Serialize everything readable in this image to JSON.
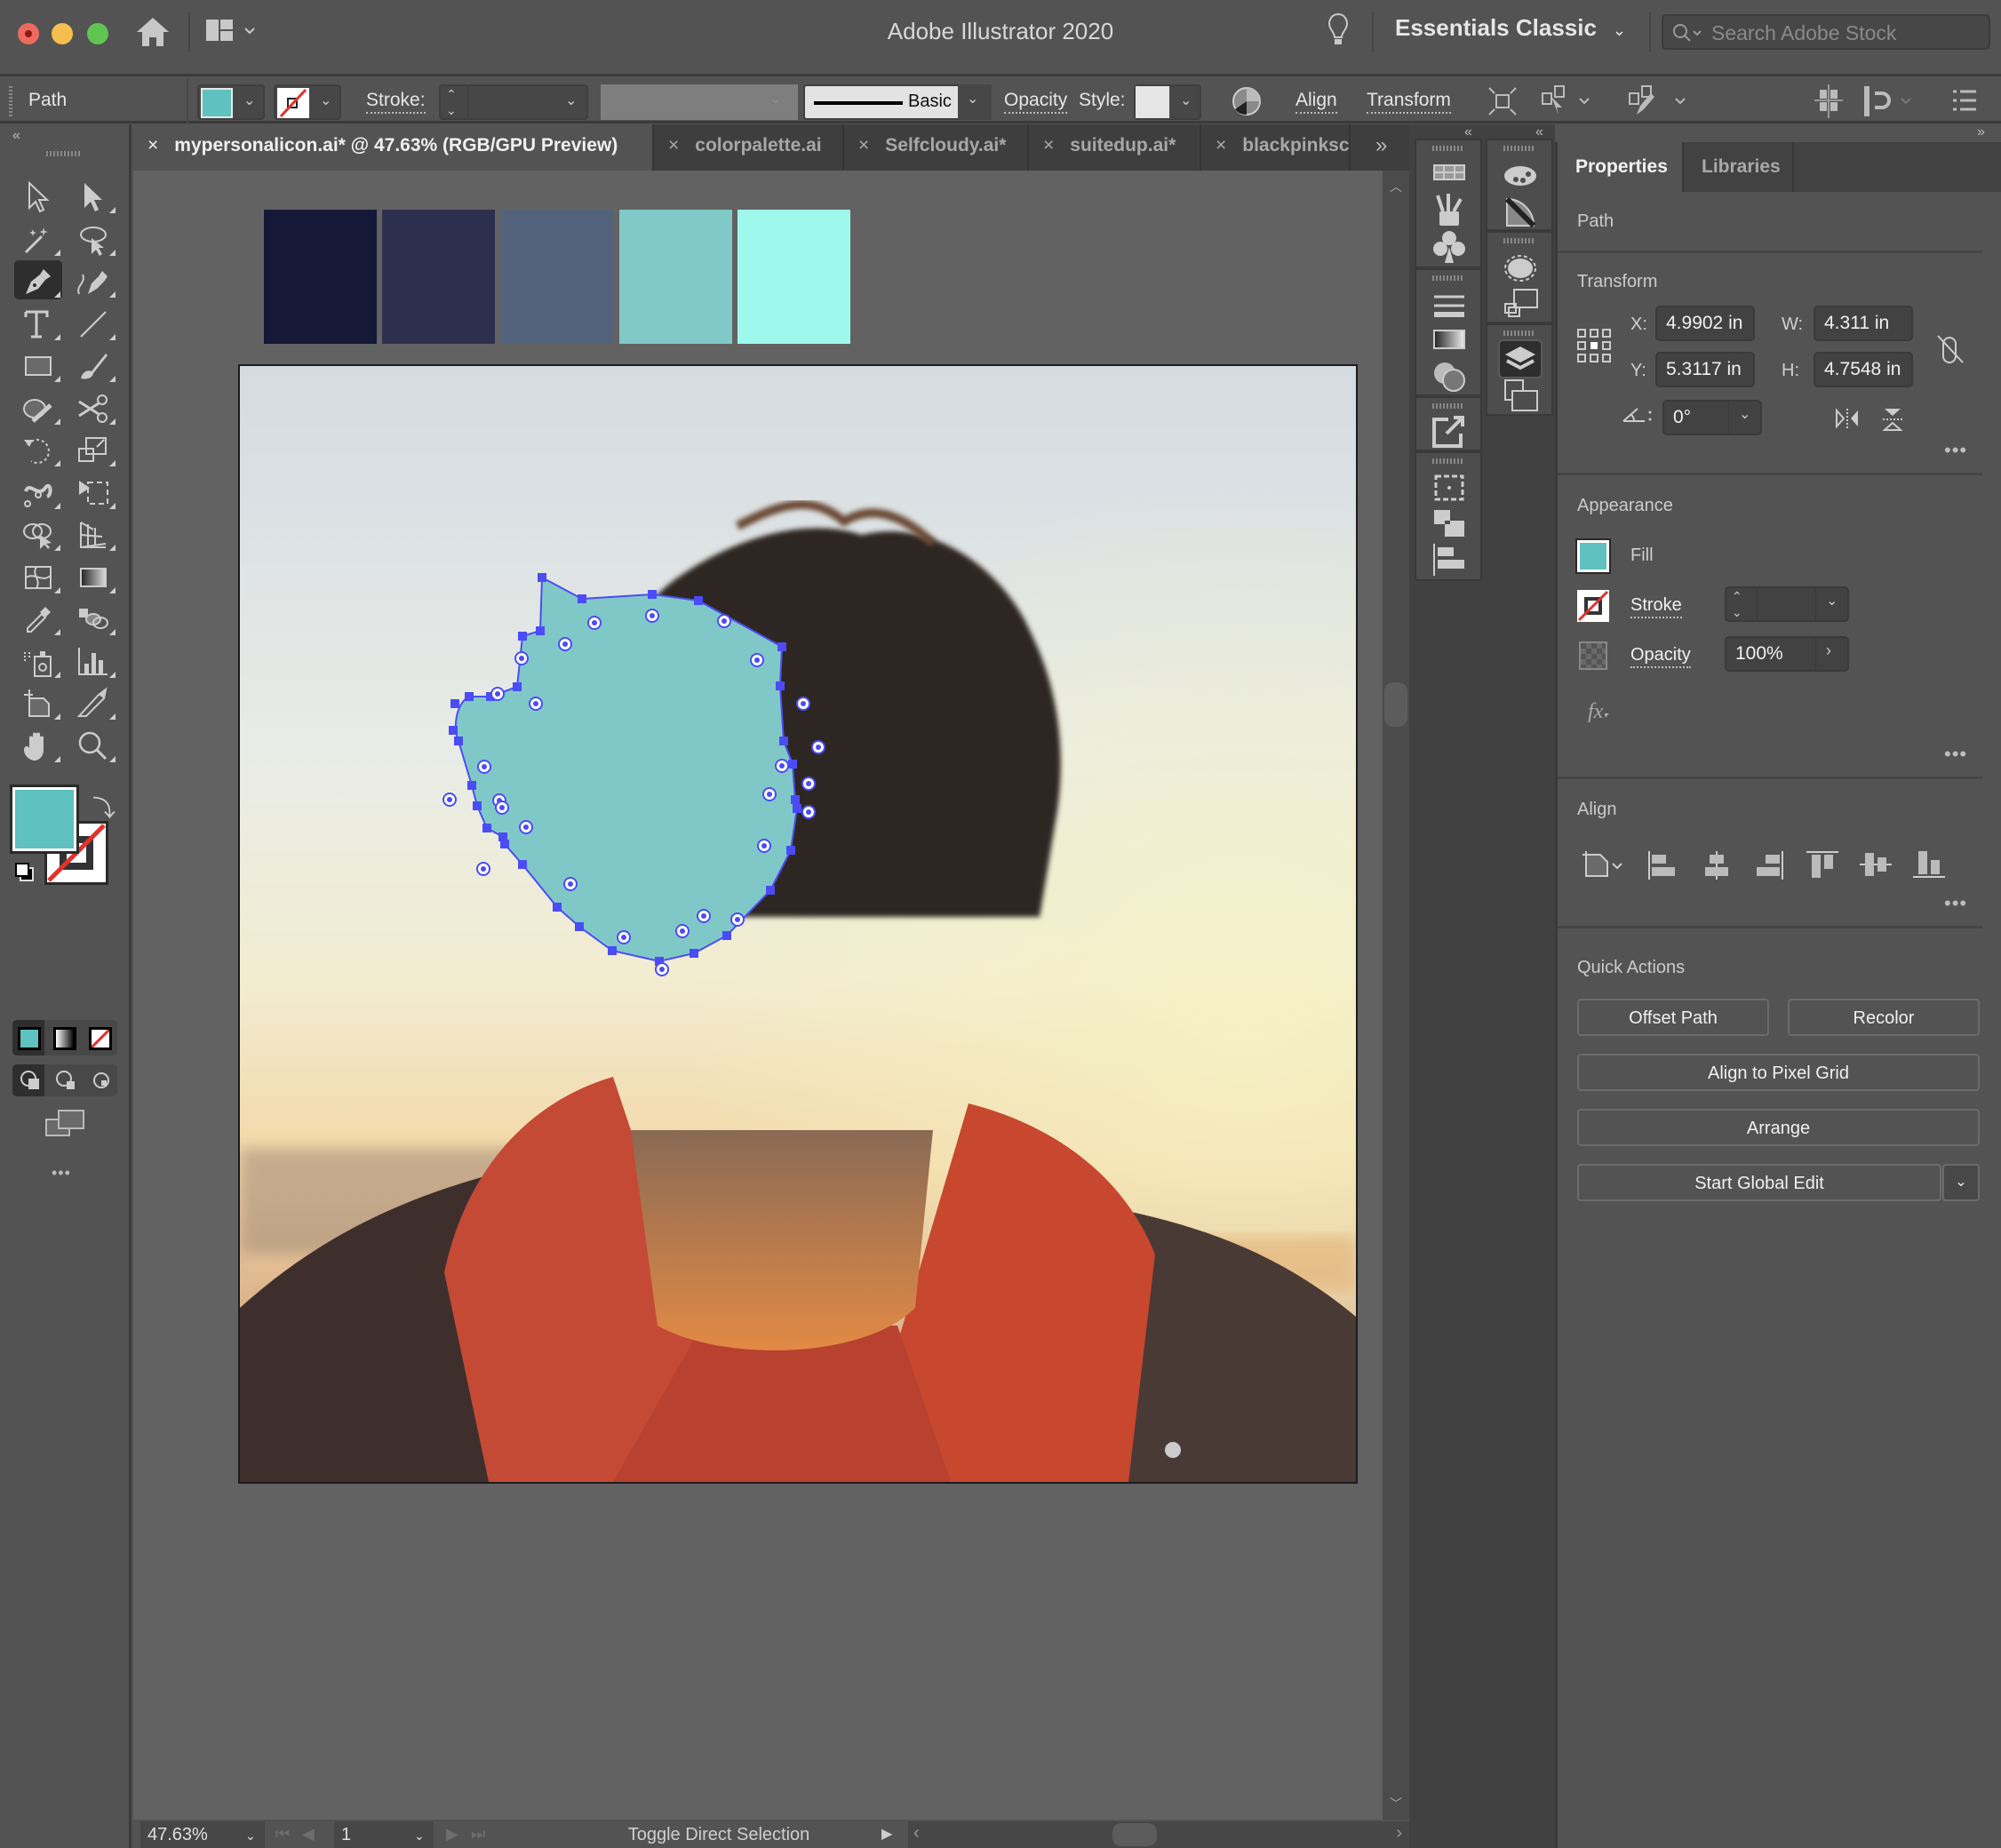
{
  "window": {
    "title": "Adobe Illustrator 2020",
    "workspace": "Essentials Classic",
    "search_placeholder": "Search Adobe Stock"
  },
  "control_bar": {
    "selection_type": "Path",
    "fill_color": "#5fc1c0",
    "stroke_label": "Stroke:",
    "stroke_weight": "",
    "brush_profile": "Basic",
    "opacity_label": "Opacity",
    "style_label": "Style:",
    "align_label": "Align",
    "transform_label": "Transform"
  },
  "tabs": [
    {
      "label": "mypersonalicon.ai* @ 47.63% (RGB/GPU Preview)",
      "active": true
    },
    {
      "label": "colorpalette.ai",
      "active": false
    },
    {
      "label": "Selfcloudy.ai*",
      "active": false
    },
    {
      "label": "suitedup.ai*",
      "active": false
    },
    {
      "label": "blackpinksc",
      "active": false
    }
  ],
  "tabs_overflow": "»",
  "toolbar": {
    "tools": [
      {
        "name": "selection-tool"
      },
      {
        "name": "direct-selection-tool"
      },
      {
        "name": "magic-wand-tool"
      },
      {
        "name": "lasso-tool"
      },
      {
        "name": "pen-tool",
        "selected": true
      },
      {
        "name": "curvature-tool"
      },
      {
        "name": "type-tool"
      },
      {
        "name": "line-segment-tool"
      },
      {
        "name": "rectangle-tool"
      },
      {
        "name": "paintbrush-tool"
      },
      {
        "name": "shaper-tool"
      },
      {
        "name": "scissors-tool"
      },
      {
        "name": "rotate-tool"
      },
      {
        "name": "scale-tool"
      },
      {
        "name": "puppet-warp-tool"
      },
      {
        "name": "free-transform-tool"
      },
      {
        "name": "shape-builder-tool"
      },
      {
        "name": "perspective-grid-tool"
      },
      {
        "name": "mesh-tool"
      },
      {
        "name": "gradient-tool"
      },
      {
        "name": "eyedropper-tool"
      },
      {
        "name": "blend-tool"
      },
      {
        "name": "symbol-sprayer-tool"
      },
      {
        "name": "column-graph-tool"
      },
      {
        "name": "artboard-tool"
      },
      {
        "name": "slice-tool"
      },
      {
        "name": "hand-tool"
      },
      {
        "name": "zoom-tool"
      }
    ],
    "fill_color": "#5fc1c0",
    "more_label": "•••"
  },
  "palette_swatches": [
    "#151837",
    "#2d2f4f",
    "#52627a",
    "#81c9c7",
    "#9ef8eb"
  ],
  "artboard": {
    "shape_fill": "#80c8c7",
    "path_color": "#4b4cf5"
  },
  "status_bar": {
    "zoom": "47.63%",
    "artboard_number": "1",
    "status_text": "Toggle Direct Selection"
  },
  "properties": {
    "tabs": [
      "Properties",
      "Libraries"
    ],
    "object_type": "Path",
    "transform": {
      "title": "Transform",
      "x_label": "X:",
      "x": "4.9902 in",
      "y_label": "Y:",
      "y": "5.3117 in",
      "w_label": "W:",
      "w": "4.311 in",
      "h_label": "H:",
      "h": "4.7548 in",
      "angle": "0°"
    },
    "appearance": {
      "title": "Appearance",
      "fill_label": "Fill",
      "fill_color": "#5fc1c0",
      "stroke_label": "Stroke",
      "stroke_value": "",
      "opacity_label": "Opacity",
      "opacity_value": "100%",
      "fx_label": "fx"
    },
    "align": {
      "title": "Align"
    },
    "quick_actions": {
      "title": "Quick Actions",
      "offset_path": "Offset Path",
      "recolor": "Recolor",
      "align_pixel_grid": "Align to Pixel Grid",
      "arrange": "Arrange",
      "start_global_edit": "Start Global Edit"
    },
    "more_label": "•••"
  }
}
